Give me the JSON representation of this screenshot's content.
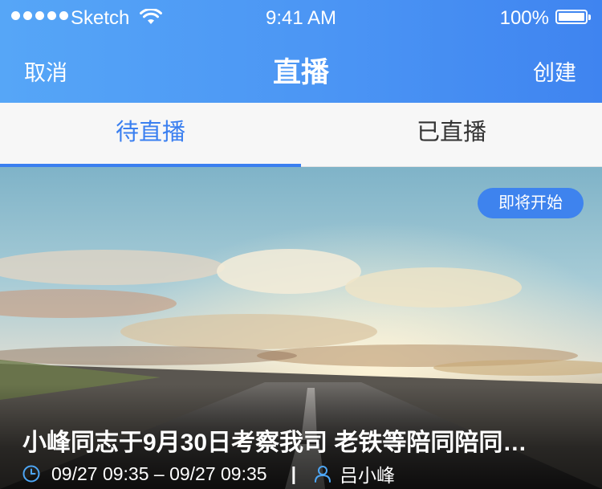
{
  "status_bar": {
    "carrier": "Sketch",
    "time": "9:41 AM",
    "battery": "100%",
    "icons": [
      "signal-dots-icon",
      "wifi-icon",
      "battery-icon"
    ]
  },
  "nav": {
    "cancel_label": "取消",
    "title": "直播",
    "create_label": "创建"
  },
  "tabs": [
    {
      "label": "待直播",
      "selected": true
    },
    {
      "label": "已直播",
      "selected": false
    }
  ],
  "card": {
    "badge": "即将开始",
    "title": "小峰同志于9月30日考察我司 老铁等陪同陪同…",
    "time_range": "09/27 09:35 – 09/27 09:35",
    "separator": "|",
    "host": "吕小峰",
    "icons": [
      "clock-icon",
      "user-icon"
    ]
  },
  "colors": {
    "header_gradient_start": "#56a6f7",
    "header_gradient_end": "#3f84f0",
    "accent": "#3a7ff0",
    "badge_bg": "#3e83ee",
    "tab_bg": "#f7f7f7",
    "meta_icon": "#4da6f5"
  }
}
